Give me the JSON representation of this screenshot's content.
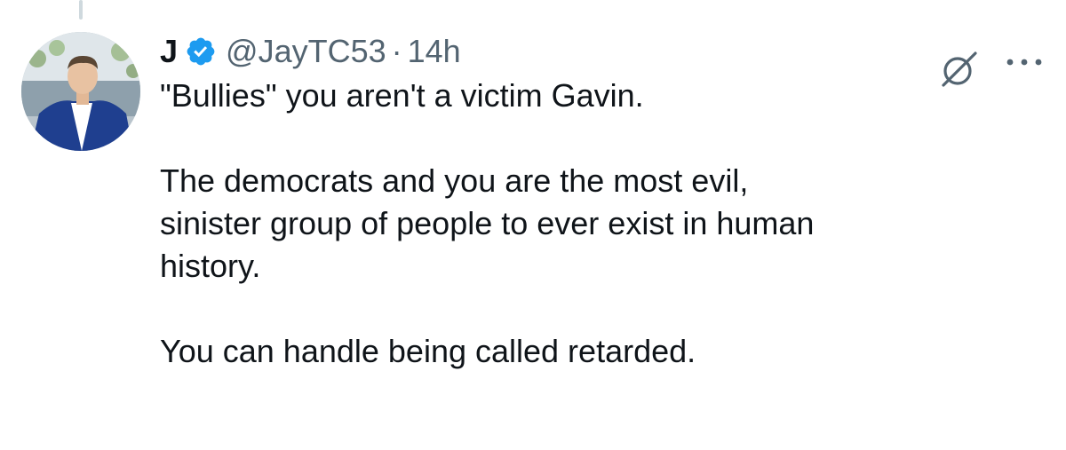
{
  "tweet": {
    "display_name": "J",
    "handle": "@JayTC53",
    "separator": "·",
    "time": "14h",
    "paragraphs": [
      "\"Bullies\" you aren't a victim Gavin.",
      "The democrats and you are the most evil,\nsinister group of people to ever exist in human\nhistory.",
      "You can handle being called retarded."
    ]
  },
  "icons": {
    "verified": "verified-badge-icon",
    "grok": "grok-icon",
    "more": "more-options-icon",
    "avatar": "profile-photo"
  },
  "colors": {
    "text_primary": "#0f1419",
    "text_secondary": "#536471",
    "verified_blue": "#1d9bf0",
    "thread_line": "#cfd9de"
  }
}
